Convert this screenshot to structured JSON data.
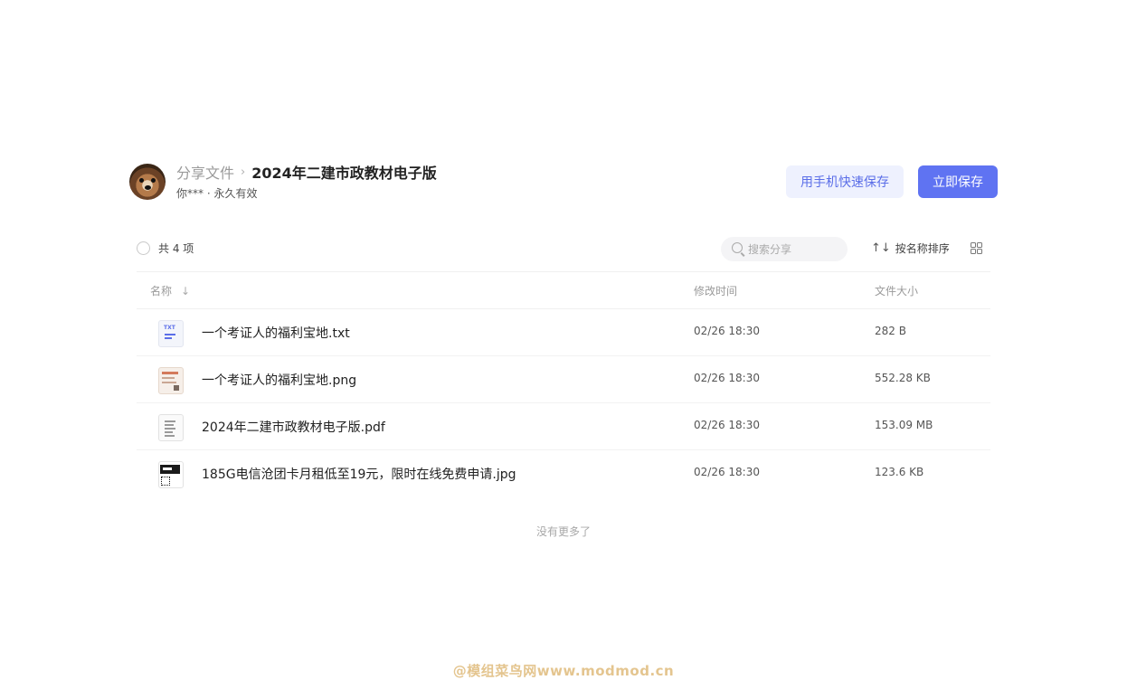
{
  "header": {
    "avatar_icon": "dog-avatar",
    "breadcrumb_parent": "分享文件",
    "breadcrumb_separator": "›",
    "title": "2024年二建市政教材电子版",
    "meta": "你*** · 永久有效",
    "mobile_save_label": "用手机快速保存",
    "save_label": "立即保存"
  },
  "toolbar": {
    "count_text": "共 4 项",
    "search_placeholder": "搜索分享",
    "sort_label": "按名称排序",
    "sort_icon": "↑↓",
    "grid_icon": "grid-view-icon"
  },
  "table": {
    "headers": {
      "name": "名称",
      "name_sort_arrow": "↓",
      "time": "修改时间",
      "size": "文件大小"
    },
    "rows": [
      {
        "icon": "txt-file-icon",
        "icon_label": "TXT",
        "name": "一个考证人的福利宝地.txt",
        "time": "02/26 18:30",
        "size": "282 B"
      },
      {
        "icon": "png-file-icon",
        "name": "一个考证人的福利宝地.png",
        "time": "02/26 18:30",
        "size": "552.28 KB"
      },
      {
        "icon": "pdf-file-icon",
        "name": "2024年二建市政教材电子版.pdf",
        "time": "02/26 18:30",
        "size": "153.09 MB"
      },
      {
        "icon": "jpg-file-icon",
        "name": "185G电信沧团卡月租低至19元，限时在线免费申请.jpg",
        "time": "02/26 18:30",
        "size": "123.6 KB"
      }
    ]
  },
  "footer": {
    "no_more": "没有更多了",
    "watermark": "@模组菜鸟网www.modmod.cn"
  },
  "colors": {
    "primary": "#5f73f2",
    "primary_light": "#eef1fe",
    "watermark": "#e4c58f"
  }
}
